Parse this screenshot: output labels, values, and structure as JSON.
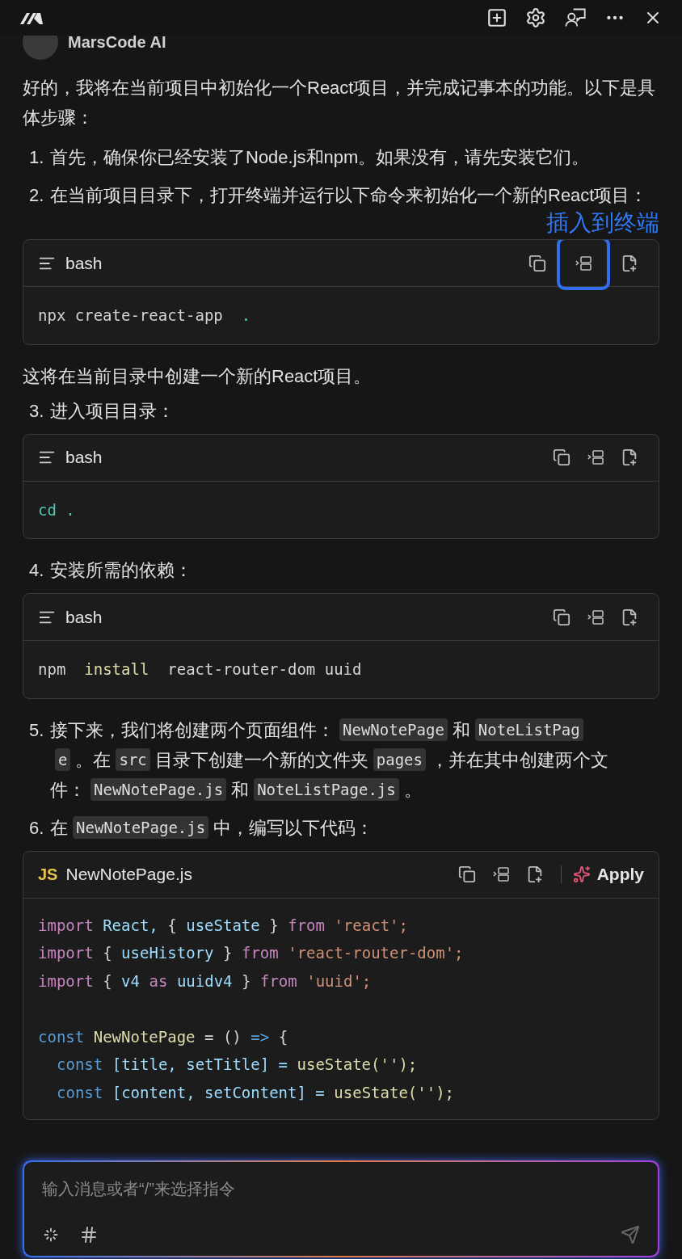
{
  "assistant": {
    "name": "MarsCode AI"
  },
  "intro": "好的，我将在当前项目中初始化一个React项目，并完成记事本的功能。以下是具体步骤：",
  "content": [
    {
      "kind": "step",
      "number": "1.",
      "lines": [
        [
          {
            "text": "首先，确保你已经安装了Node.js和npm。如果没有，请先安装它们。",
            "kind": "text"
          }
        ]
      ]
    },
    {
      "kind": "step",
      "number": "2.",
      "lines": [
        [
          {
            "text": "在当前项目目录下，打开终端并运行以下命令来初始化一个新的React项目：",
            "kind": "text"
          }
        ]
      ]
    },
    {
      "kind": "callout",
      "text": "插入到终端"
    },
    {
      "kind": "code",
      "language": "bash",
      "highlight": true,
      "lines": [
        {
          "tokens": [
            {
              "t": "npx create-react-app ",
              "color": "#d4d4d4"
            },
            {
              "t": ".",
              "color": "#4ec9b0"
            }
          ]
        }
      ]
    },
    {
      "kind": "para",
      "text": "这将在当前目录中创建一个新的React项目。"
    },
    {
      "kind": "step",
      "number": "3.",
      "lines": [
        [
          {
            "text": "进入项目目录：",
            "kind": "text"
          }
        ]
      ]
    },
    {
      "kind": "code",
      "language": "bash",
      "highlight": false,
      "lines": [
        {
          "tokens": [
            {
              "t": "cd .",
              "color": "#4ec9b0"
            }
          ]
        }
      ]
    },
    {
      "kind": "step",
      "number": "4.",
      "lines": [
        [
          {
            "text": "安装所需的依赖：",
            "kind": "text"
          }
        ]
      ]
    },
    {
      "kind": "code",
      "language": "bash",
      "highlight": false,
      "lines": [
        {
          "tokens": [
            {
              "t": "npm ",
              "color": "#d4d4d4"
            },
            {
              "t": "install",
              "color": "#dcdcaa"
            },
            {
              "t": " react-router-dom uuid",
              "color": "#d4d4d4"
            }
          ]
        }
      ]
    },
    {
      "kind": "step",
      "number": "5.",
      "lines": [
        [
          {
            "text": "接下来，我们将创建两个页面组件：",
            "kind": "text"
          },
          {
            "text": "NewNotePage",
            "kind": "code"
          },
          {
            "text": "和",
            "kind": "text"
          },
          {
            "text": "NoteListPag",
            "kind": "code"
          }
        ],
        [
          {
            "text": "e",
            "kind": "code"
          },
          {
            "text": "。在",
            "kind": "text"
          },
          {
            "text": "src",
            "kind": "code"
          },
          {
            "text": "目录下创建一个新的文件夹",
            "kind": "text"
          },
          {
            "text": "pages",
            "kind": "code"
          },
          {
            "text": "，并在其中创建两个文",
            "kind": "text"
          }
        ],
        [
          {
            "text": "件：",
            "kind": "text"
          },
          {
            "text": "NewNotePage.js",
            "kind": "code"
          },
          {
            "text": "和",
            "kind": "text"
          },
          {
            "text": "NoteListPage.js",
            "kind": "code"
          },
          {
            "text": "。",
            "kind": "text"
          }
        ]
      ]
    },
    {
      "kind": "step",
      "number": "6.",
      "lines": [
        [
          {
            "text": "在",
            "kind": "text"
          },
          {
            "text": "NewNotePage.js",
            "kind": "code"
          },
          {
            "text": "中，编写以下代码：",
            "kind": "text"
          }
        ]
      ]
    },
    {
      "kind": "code",
      "language": "JS",
      "filename": "NewNotePage.js",
      "apply": "Apply",
      "highlight": false,
      "lines": [
        {
          "tokens": [
            {
              "t": "import",
              "color": "#c586c0"
            },
            {
              "t": "React,",
              "color": "#9cdcfe"
            },
            {
              "t": "{",
              "color": "#d4d4d4"
            },
            {
              "t": "useState",
              "color": "#9cdcfe"
            },
            {
              "t": "}",
              "color": "#d4d4d4"
            },
            {
              "t": "from",
              "color": "#c586c0"
            },
            {
              "t": "'react';",
              "color": "#ce9178"
            }
          ]
        },
        {
          "tokens": [
            {
              "t": "import",
              "color": "#c586c0"
            },
            {
              "t": "{",
              "color": "#d4d4d4"
            },
            {
              "t": "useHistory",
              "color": "#9cdcfe"
            },
            {
              "t": "}",
              "color": "#d4d4d4"
            },
            {
              "t": "from",
              "color": "#c586c0"
            },
            {
              "t": "'react-router-dom';",
              "color": "#ce9178"
            }
          ]
        },
        {
          "tokens": [
            {
              "t": "import",
              "color": "#c586c0"
            },
            {
              "t": "{",
              "color": "#d4d4d4"
            },
            {
              "t": "v4",
              "color": "#9cdcfe"
            },
            {
              "t": "as",
              "color": "#c586c0"
            },
            {
              "t": "uuidv4",
              "color": "#9cdcfe"
            },
            {
              "t": "}",
              "color": "#d4d4d4"
            },
            {
              "t": "from",
              "color": "#c586c0"
            },
            {
              "t": "'uuid';",
              "color": "#ce9178"
            }
          ]
        },
        {
          "gap_before": true,
          "tokens": [
            {
              "t": "const",
              "color": "#569cd6"
            },
            {
              "t": "NewNotePage",
              "color": "#dcdcaa"
            },
            {
              "t": "= ()",
              "color": "#d4d4d4"
            },
            {
              "t": "=>",
              "color": "#569cd6"
            },
            {
              "t": "{",
              "color": "#d4d4d4"
            }
          ]
        },
        {
          "indent": true,
          "tokens": [
            {
              "t": "const",
              "color": "#569cd6"
            },
            {
              "t": "[title, setTitle] =",
              "color": "#9cdcfe"
            },
            {
              "t": "useState('');",
              "color": "#dcdcaa"
            }
          ]
        },
        {
          "indent": true,
          "tokens": [
            {
              "t": "const",
              "color": "#569cd6"
            },
            {
              "t": "[content, setContent] =",
              "color": "#9cdcfe"
            },
            {
              "t": "useState('');",
              "color": "#dcdcaa"
            }
          ]
        }
      ]
    }
  ],
  "input": {
    "placeholder": "输入消息或者“/”来选择指令"
  }
}
